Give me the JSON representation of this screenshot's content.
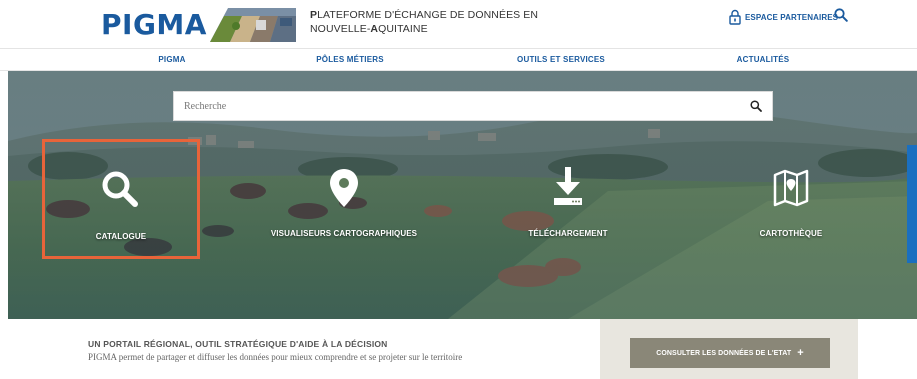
{
  "header": {
    "logo": "PIGMA",
    "tagline_line1_cap": "P",
    "tagline_line1": "LATEFORME D'ÉCHANGE DE DONNÉES EN",
    "tagline_line2_a": "NOUVELLE-",
    "tagline_line2_cap": "A",
    "tagline_line2_b": "QUITAINE",
    "partner_label": "ESPACE PARTENAIRES",
    "lock_icon": "lock-icon",
    "search_icon": "search-icon"
  },
  "nav": {
    "items": [
      {
        "label": "PIGMA"
      },
      {
        "label": "PÔLES MÉTIERS"
      },
      {
        "label": "OUTILS ET SERVICES"
      },
      {
        "label": "ACTUALITÉS"
      }
    ]
  },
  "hero": {
    "search_placeholder": "Recherche",
    "tiles": [
      {
        "label": "CATALOGUE",
        "icon": "magnifier-icon",
        "active": true
      },
      {
        "label": "VISUALISEURS CARTOGRAPHIQUES",
        "icon": "map-pin-icon",
        "active": false
      },
      {
        "label": "TÉLÉCHARGEMENT",
        "icon": "download-icon",
        "active": false
      },
      {
        "label": "CARTOTHÈQUE",
        "icon": "folded-map-icon",
        "active": false
      }
    ]
  },
  "bottom": {
    "title": "UN PORTAIL RÉGIONAL, OUTIL STRATÉGIQUE D'AIDE À LA DÉCISION",
    "subtitle": "PIGMA permet de partager et diffuser les données pour mieux comprendre et se projeter sur le territoire",
    "cta_label": "CONSULTER LES DONNÉES DE L'ETAT",
    "cta_plus": "+"
  },
  "colors": {
    "brand_blue": "#1a5a9e",
    "highlight_orange": "#e8643a",
    "cta_gray": "#8a8778",
    "panel_beige": "#e8e6df"
  }
}
